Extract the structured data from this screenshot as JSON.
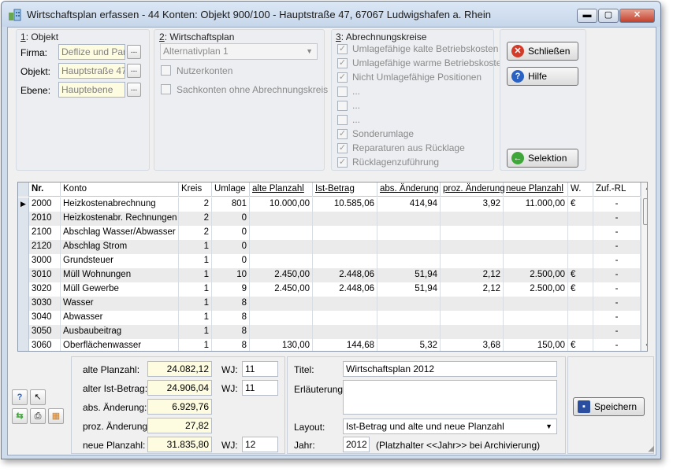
{
  "window": {
    "title": "Wirtschaftsplan erfassen - 44 Konten:  Objekt 900/100 - Hauptstraße 47, 67067 Ludwigshafen a. Rhein",
    "controls": {
      "minimize": "▬",
      "maximize": "▢",
      "close": "✕"
    }
  },
  "objekt": {
    "title_key": "1",
    "title_rest": ": Objekt",
    "firma_label": "Firma:",
    "firma_value": "Deflize und Partr",
    "objekt_label": "Objekt:",
    "objekt_value": "Hauptstraße 47,",
    "ebene_label": "Ebene:",
    "ebene_value": "Hauptebene",
    "ellipsis": "..."
  },
  "wirtschaftsplan": {
    "title_key": "2",
    "title_rest": ": Wirtschaftsplan",
    "plan_select": "Alternativplan 1",
    "nutzerkonten": "Nutzerkonten",
    "sachkonten": "Sachkonten ohne Abrechnungskreis"
  },
  "abrechnungskreise": {
    "title_key": "3",
    "title_rest": ": Abrechnungskreise",
    "items": [
      {
        "label": "Umlagefähige kalte Betriebskosten",
        "checked": true
      },
      {
        "label": "Umlagefähige warme Betriebskosten",
        "checked": true
      },
      {
        "label": "Nicht Umlagefähige Positionen",
        "checked": true
      },
      {
        "label": "...",
        "checked": false
      },
      {
        "label": "...",
        "checked": false
      },
      {
        "label": "...",
        "checked": false
      },
      {
        "label": "Sonderumlage",
        "checked": true
      },
      {
        "label": "Reparaturen aus Rücklage",
        "checked": true
      },
      {
        "label": "Rücklagenzuführung",
        "checked": true
      }
    ]
  },
  "buttons": {
    "schliessen": "Schließen",
    "hilfe": "Hilfe",
    "selektion": "Selektion",
    "speichern": "Speichern"
  },
  "table": {
    "headers": [
      "Nr.",
      "Konto",
      "Kreis",
      "Umlage",
      "alte Planzahl",
      "Ist-Betrag",
      "abs. Änderung",
      "proz. Änderung",
      "neue Planzahl",
      "W.",
      "Zuf.-RL"
    ],
    "rows": [
      [
        "2000",
        "Heizkostenabrechnung",
        "2",
        "801",
        "10.000,00",
        "10.585,06",
        "414,94",
        "3,92",
        "11.000,00",
        "€",
        "-"
      ],
      [
        "2010",
        "Heizkostenabr. Rechnungen",
        "2",
        "0",
        "",
        "",
        "",
        "",
        "",
        "",
        "-"
      ],
      [
        "2100",
        "Abschlag Wasser/Abwasser",
        "2",
        "0",
        "",
        "",
        "",
        "",
        "",
        "",
        "-"
      ],
      [
        "2120",
        "Abschlag Strom",
        "1",
        "0",
        "",
        "",
        "",
        "",
        "",
        "",
        "-"
      ],
      [
        "3000",
        "Grundsteuer",
        "1",
        "0",
        "",
        "",
        "",
        "",
        "",
        "",
        "-"
      ],
      [
        "3010",
        "Müll Wohnungen",
        "1",
        "10",
        "2.450,00",
        "2.448,06",
        "51,94",
        "2,12",
        "2.500,00",
        "€",
        "-"
      ],
      [
        "3020",
        "Müll Gewerbe",
        "1",
        "9",
        "2.450,00",
        "2.448,06",
        "51,94",
        "2,12",
        "2.500,00",
        "€",
        "-"
      ],
      [
        "3030",
        "Wasser",
        "1",
        "8",
        "",
        "",
        "",
        "",
        "",
        "",
        "-"
      ],
      [
        "3040",
        "Abwasser",
        "1",
        "8",
        "",
        "",
        "",
        "",
        "",
        "",
        "-"
      ],
      [
        "3050",
        "Ausbaubeitrag",
        "1",
        "8",
        "",
        "",
        "",
        "",
        "",
        "",
        "-"
      ],
      [
        "3060",
        "Oberflächenwasser",
        "1",
        "8",
        "130,00",
        "144,68",
        "5,32",
        "3,68",
        "150,00",
        "€",
        "-"
      ]
    ]
  },
  "summary": {
    "alte_label": "alte Planzahl:",
    "alte_value": "24.082,12",
    "ist_label": "alter Ist-Betrag:",
    "ist_value": "24.906,04",
    "abs_label": "abs. Änderung:",
    "abs_value": "6.929,76",
    "proz_label": "proz. Änderung:",
    "proz_value": "27,82",
    "neue_label": "neue Planzahl:",
    "neue_value": "31.835,80",
    "wj_label": "WJ:",
    "wj_alte": "11",
    "wj_ist": "11",
    "wj_neue": "12"
  },
  "details": {
    "titel_label": "Titel:",
    "titel_value": "Wirtschaftsplan 2012",
    "erlaeuterung_label": "Erläuterung:",
    "erlaeuterung_value": "",
    "layout_label": "Layout:",
    "layout_value": "Ist-Betrag und alte und neue Planzahl",
    "jahr_label": "Jahr:",
    "jahr_value": "2012",
    "jahr_hint": "(Platzhalter <<Jahr>> bei Archivierung)"
  },
  "colors": {
    "field_yellow": "#fdfbe0",
    "accent_blue": "#2a62c4",
    "close_red": "#c4402b"
  }
}
